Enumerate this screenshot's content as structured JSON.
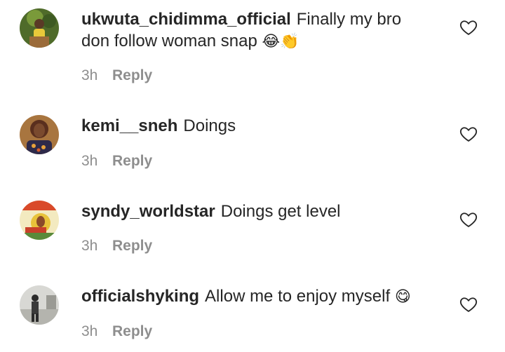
{
  "comments": [
    {
      "username": "ukwuta_chidimma_official",
      "text": "Finally my bro don follow woman snap",
      "emoji": "😂👏",
      "time": "3h",
      "reply_label": "Reply",
      "like_icon": "heart-outline-icon"
    },
    {
      "username": "kemi__sneh",
      "text": "Doings",
      "emoji": "",
      "time": "3h",
      "reply_label": "Reply",
      "like_icon": "heart-outline-icon"
    },
    {
      "username": "syndy_worldstar",
      "text": "Doings get level",
      "emoji": "",
      "time": "3h",
      "reply_label": "Reply",
      "like_icon": "heart-outline-icon"
    },
    {
      "username": "officialshyking",
      "text": "Allow me to enjoy myself",
      "emoji": "😋",
      "time": "3h",
      "reply_label": "Reply",
      "like_icon": "heart-outline-icon"
    }
  ],
  "colors": {
    "text_primary": "#262626",
    "text_secondary": "#8e8e8e",
    "background": "#ffffff"
  }
}
